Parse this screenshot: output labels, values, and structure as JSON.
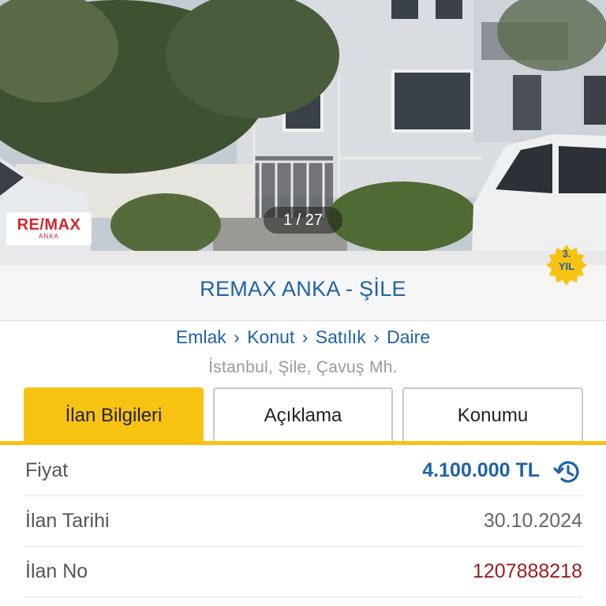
{
  "photo": {
    "counter": "1 / 27",
    "agent_logo": {
      "brand": "RE/MAX",
      "sub": "ANKA"
    }
  },
  "store": {
    "name": "REMAX ANKA - ŞİLE",
    "badge": {
      "years": "3.",
      "label": "YIL"
    }
  },
  "breadcrumb": {
    "items": [
      "Emlak",
      "Konut",
      "Satılık",
      "Daire"
    ],
    "separator": "›"
  },
  "location": "İstanbul, Şile, Çavuş Mh.",
  "tabs": [
    {
      "label": "İlan Bilgileri",
      "active": true
    },
    {
      "label": "Açıklama",
      "active": false
    },
    {
      "label": "Konumu",
      "active": false
    }
  ],
  "details": {
    "price": {
      "label": "Fiyat",
      "value": "4.100.000 TL",
      "icon": "history-icon"
    },
    "date": {
      "label": "İlan Tarihi",
      "value": "30.10.2024"
    },
    "number": {
      "label": "İlan No",
      "value": "1207888218"
    }
  },
  "colors": {
    "accent_yellow": "#f8c213",
    "link_blue": "#1e62a8",
    "id_red": "#9b1c1c"
  }
}
